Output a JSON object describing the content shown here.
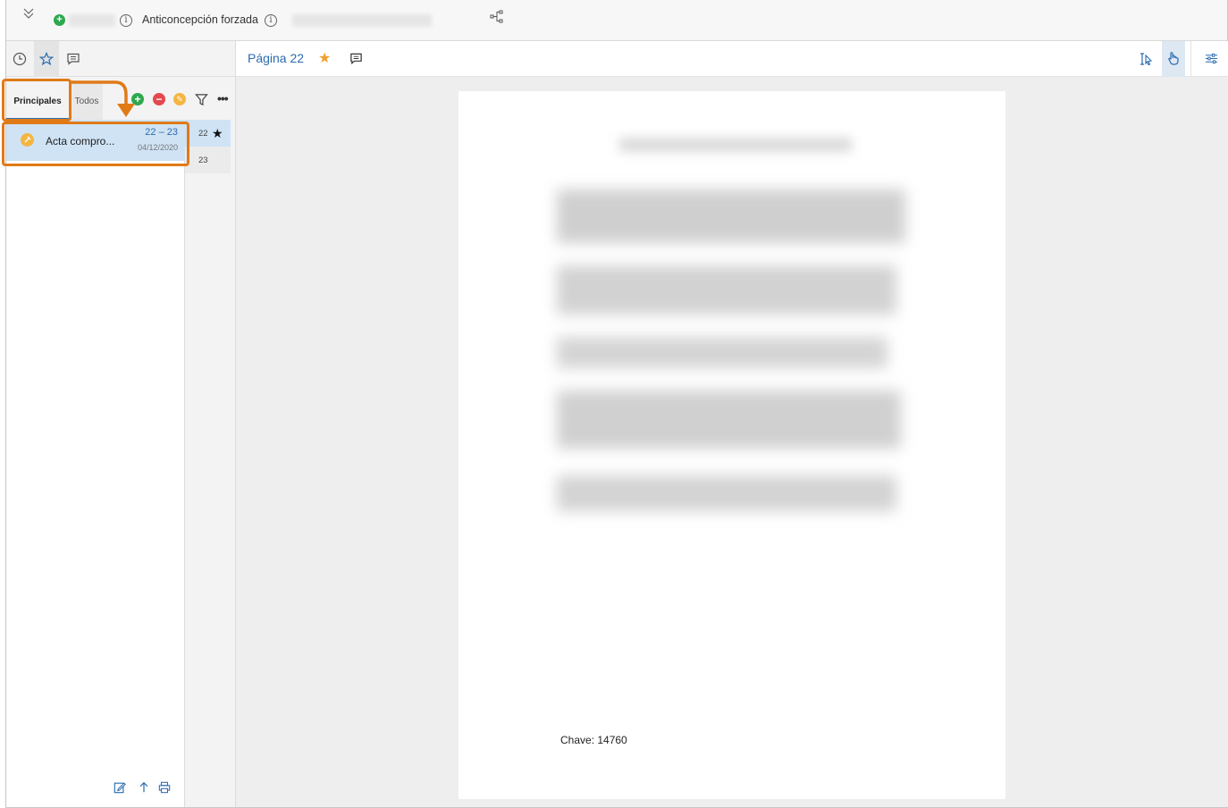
{
  "topbar": {
    "document_title": "Anticoncepción forzada"
  },
  "left_panel": {
    "tabs": [
      {
        "label": "Principales"
      },
      {
        "label": "Todos"
      }
    ],
    "bookmark": {
      "title": "Acta compro...",
      "pages": "22 – 23",
      "date": "04/12/2020"
    },
    "page_rows": [
      {
        "number": "22"
      },
      {
        "number": "23"
      }
    ]
  },
  "viewer": {
    "page_label": "Página 22",
    "page_key": "Chave: 14760"
  },
  "colors": {
    "accent": "#2b6cb0",
    "highlight": "#e07a17",
    "selected_row": "#cfe3f5",
    "add": "#2ea84f",
    "remove": "#e5484d",
    "bookmark": "#f5b542"
  }
}
